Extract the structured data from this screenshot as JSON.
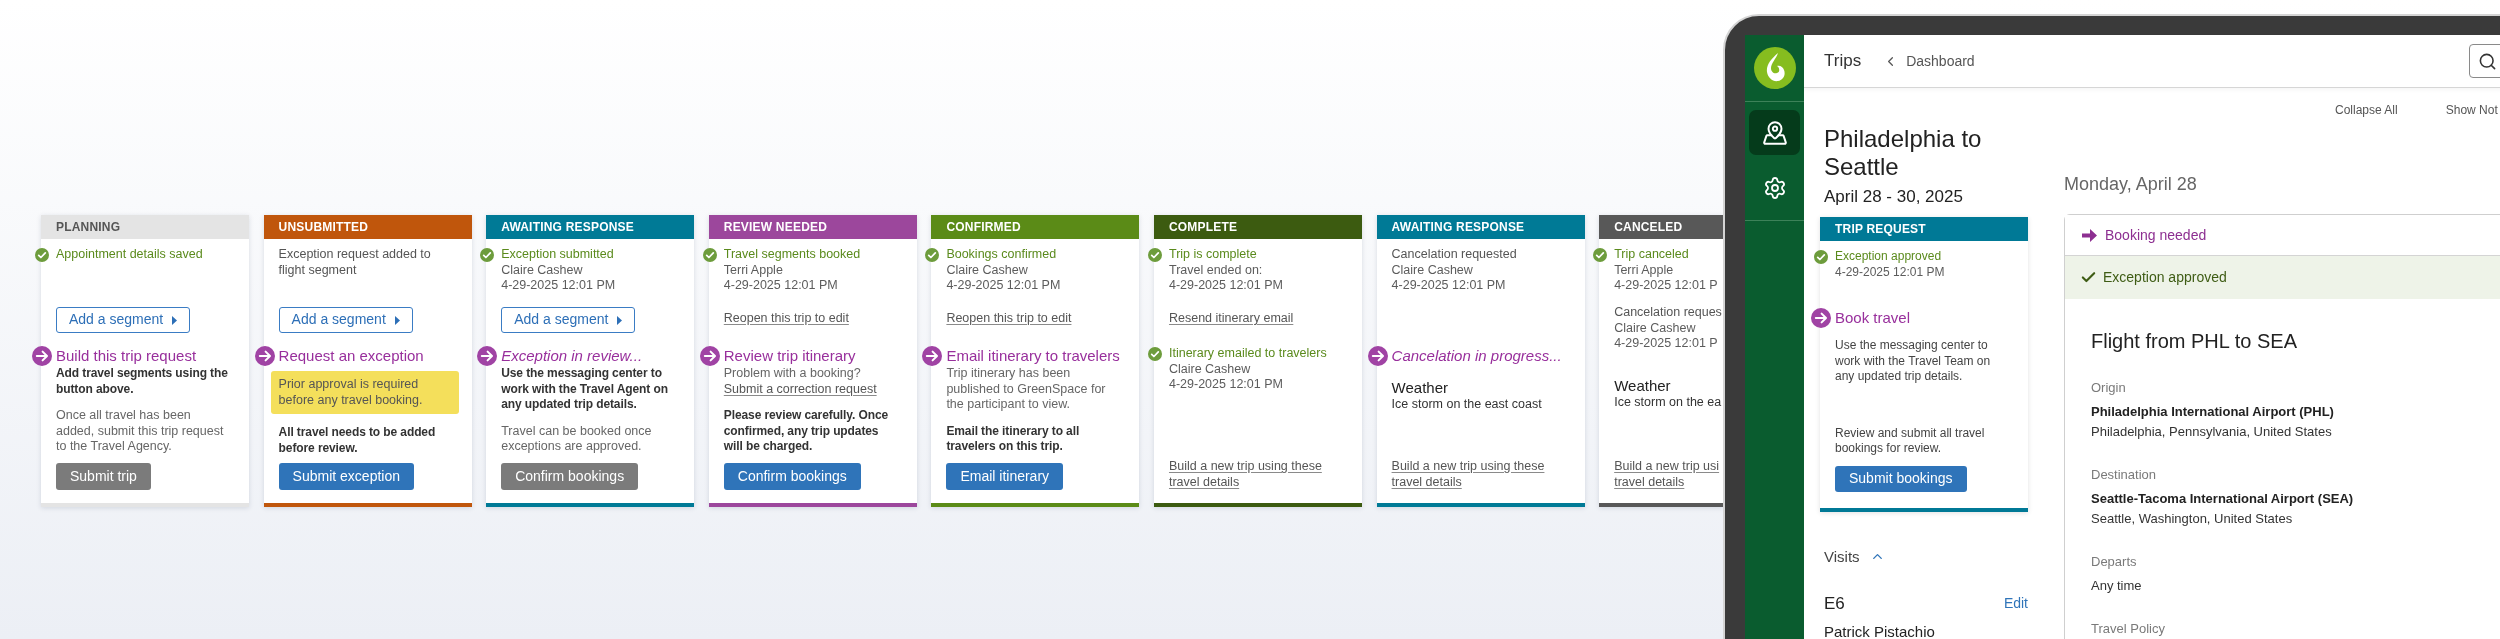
{
  "status_cards": [
    {
      "status": "PLANNING",
      "color": "#e4e4e4",
      "events": [
        {
          "done": true,
          "title": "Appointment details saved"
        }
      ],
      "action": {
        "kind": "segment_button",
        "label": "Add a segment"
      },
      "blocks": [
        {
          "kind": "step",
          "text": "Build this trip request",
          "in_progress": false
        },
        {
          "kind": "strong",
          "text": "Add travel segments using the button above."
        },
        {
          "kind": "muted",
          "text": "Once all travel has been added, submit this trip request to the Travel Agency."
        }
      ],
      "footer": {
        "kind": "button",
        "label": "Submit trip",
        "disabled": true
      }
    },
    {
      "status": "UNSUBMITTED",
      "color": "#c0560c",
      "events": [
        {
          "done": false,
          "title": "Exception request added to flight segment"
        }
      ],
      "action": {
        "kind": "segment_button",
        "label": "Add a segment"
      },
      "blocks": [
        {
          "kind": "step",
          "text": "Request an exception",
          "in_progress": false
        },
        {
          "kind": "alert",
          "text": "Prior approval is required before any travel booking."
        },
        {
          "kind": "strong",
          "text": "All travel needs to be added before review."
        }
      ],
      "footer": {
        "kind": "button",
        "label": "Submit exception",
        "disabled": false
      }
    },
    {
      "status": "AWAITING RESPONSE",
      "color": "#007a96",
      "events": [
        {
          "done": true,
          "title": "Exception submitted",
          "lines": [
            "Claire Cashew",
            "4-29-2025 12:01 PM"
          ]
        }
      ],
      "action": {
        "kind": "segment_button",
        "label": "Add a segment"
      },
      "blocks": [
        {
          "kind": "step",
          "text": "Exception in review...",
          "in_progress": true
        },
        {
          "kind": "strong",
          "text": "Use the messaging center to work with the Travel Agent on any updated trip details."
        },
        {
          "kind": "muted",
          "text": "Travel can be booked once exceptions are approved."
        }
      ],
      "footer": {
        "kind": "button",
        "label": "Confirm bookings",
        "disabled": true
      }
    },
    {
      "status": "REVIEW NEEDED",
      "color": "#9c479c",
      "events": [
        {
          "done": true,
          "title": "Travel segments booked",
          "lines": [
            "Terri Apple",
            "4-29-2025 12:01 PM"
          ]
        }
      ],
      "action": {
        "kind": "link",
        "label": "Reopen this trip to edit"
      },
      "blocks": [
        {
          "kind": "step",
          "text": "Review trip itinerary",
          "in_progress": false
        },
        {
          "kind": "muted",
          "text": "Problem with a booking?"
        },
        {
          "kind": "link",
          "text": "Submit a correction request"
        },
        {
          "kind": "strong",
          "text": "Please review carefully. Once confirmed, any trip updates will be charged."
        }
      ],
      "footer": {
        "kind": "button",
        "label": "Confirm bookings",
        "disabled": false
      }
    },
    {
      "status": "CONFIRMED",
      "color": "#5b8b17",
      "events": [
        {
          "done": true,
          "title": "Bookings confirmed",
          "lines": [
            "Claire Cashew",
            "4-29-2025 12:01 PM"
          ]
        }
      ],
      "action": {
        "kind": "link",
        "label": "Reopen this trip to edit"
      },
      "blocks": [
        {
          "kind": "step",
          "text": "Email itinerary to travelers",
          "in_progress": false
        },
        {
          "kind": "muted",
          "text": "Trip itinerary has been published to GreenSpace for the participant to view."
        },
        {
          "kind": "strong",
          "text": "Email the itinerary to all travelers on this trip."
        }
      ],
      "footer": {
        "kind": "button",
        "label": "Email itinerary",
        "disabled": false
      }
    },
    {
      "status": "COMPLETE",
      "color": "#3c5b10",
      "events": [
        {
          "done": true,
          "title": "Trip is complete",
          "lines": [
            "Travel ended on:",
            "4-29-2025 12:01 PM"
          ]
        }
      ],
      "action": {
        "kind": "link",
        "label": "Resend itinerary email"
      },
      "blocks": [
        {
          "kind": "event",
          "done": true,
          "title": "Itinerary emailed to travelers",
          "lines": [
            "Claire Cashew",
            "4-29-2025 12:01 PM"
          ]
        }
      ],
      "footer": {
        "kind": "link",
        "label": "Build a new trip using these travel details"
      }
    },
    {
      "status": "AWAITING RESPONSE",
      "color": "#007a96",
      "events": [
        {
          "done": false,
          "title": "Cancelation requested",
          "lines": [
            "Claire Cashew",
            "4-29-2025 12:01 PM"
          ]
        }
      ],
      "blocks": [
        {
          "kind": "step",
          "text": "Cancelation in progress...",
          "in_progress": true
        },
        {
          "kind": "reason",
          "title": "Weather",
          "text": "Ice storm on the east coast"
        }
      ],
      "footer": {
        "kind": "link",
        "label": "Build a new trip using these travel details"
      }
    },
    {
      "status": "CANCELED",
      "color": "#585858",
      "events": [
        {
          "done": true,
          "title": "Trip canceled",
          "lines": [
            "Terri Apple",
            "4-29-2025 12:01 P"
          ]
        },
        {
          "done": false,
          "title": "Cancelation reques",
          "lines": [
            "Claire Cashew",
            "4-29-2025 12:01 P"
          ]
        }
      ],
      "blocks": [
        {
          "kind": "reason",
          "title": "Weather",
          "text": "Ice storm on the ea"
        }
      ],
      "footer": {
        "kind": "link",
        "label": "Build a new trip usi travel details"
      }
    }
  ],
  "app": {
    "header": {
      "title": "Trips",
      "breadcrumb": "Dashboard"
    },
    "toolbar": [
      "Collapse All",
      "Show Not"
    ],
    "trip": {
      "title": "Philadelphia to Seattle",
      "dates": "April 28 - 30, 2025"
    },
    "trip_card": {
      "status": "TRIP REQUEST",
      "color": "#007996",
      "events": [
        {
          "done": true,
          "title": "Exception approved",
          "lines": [
            "4-29-2025 12:01 PM"
          ]
        }
      ],
      "blocks": [
        {
          "kind": "step",
          "text": "Book travel",
          "in_progress": false
        },
        {
          "kind": "body",
          "text": "Use the messaging center to work with the Travel Team on any updated trip details."
        },
        {
          "kind": "body",
          "text": "Review and submit all travel bookings for review."
        }
      ],
      "footer": {
        "kind": "button",
        "label": "Submit bookings",
        "disabled": false
      }
    },
    "visits": {
      "title": "Visits",
      "expanded": true,
      "items": [
        {
          "code": "E6",
          "action": "Edit",
          "name": "Patrick Pistachio"
        }
      ]
    },
    "day": {
      "heading": "Monday, April 28",
      "banners": [
        {
          "kind": "todo",
          "text": "Booking needed"
        },
        {
          "kind": "approved",
          "text": "Exception approved"
        }
      ],
      "segment": {
        "title": "Flight from PHL to SEA",
        "fields": [
          {
            "label": "Origin",
            "value": "Philadelphia International Airport (PHL)",
            "detail": "Philadelphia, Pennsylvania, United States"
          },
          {
            "label": "Destination",
            "value": "Seattle-Tacoma International Airport (SEA)",
            "detail": "Seattle, Washington, United States"
          },
          {
            "label": "Departs",
            "detail": "Any time"
          },
          {
            "label": "Travel Policy"
          }
        ]
      }
    }
  }
}
